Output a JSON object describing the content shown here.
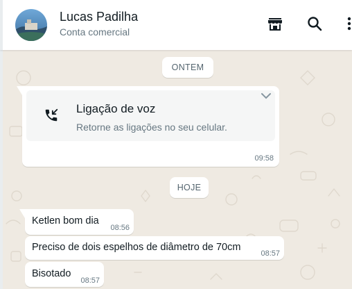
{
  "header": {
    "name": "Lucas Padilha",
    "subtitle": "Conta comercial",
    "icons": [
      "catalog-icon",
      "search-icon",
      "menu-icon"
    ]
  },
  "colors": {
    "chat_background": "#efeae2",
    "bubble": "#ffffff",
    "text_primary": "#111b21",
    "text_secondary": "#667781"
  },
  "date_chips": {
    "yesterday": "ONTEM",
    "today": "HOJE"
  },
  "call_message": {
    "title": "Ligação de voz",
    "subtitle": "Retorne as ligações no seu celular.",
    "time": "09:58",
    "icon": "missed-call-icon"
  },
  "messages": [
    {
      "text": "Ketlen bom dia",
      "time": "08:56"
    },
    {
      "text": "Preciso de dois espelhos de diâmetro de 70cm",
      "time": "08:57"
    },
    {
      "text": "Bisotado",
      "time": "08:57"
    }
  ]
}
